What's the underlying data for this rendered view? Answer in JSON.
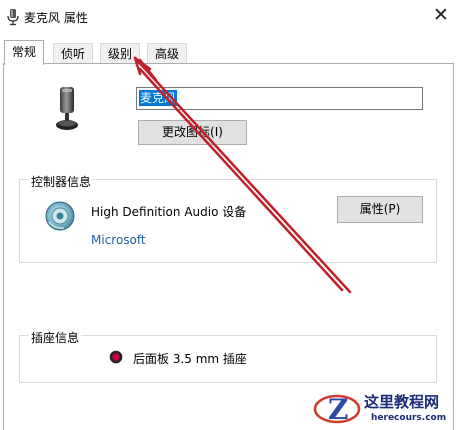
{
  "window": {
    "title": "麦克风 属性",
    "close_symbol": "✕"
  },
  "tabs": [
    {
      "label": "常规",
      "active": true
    },
    {
      "label": "侦听",
      "active": false
    },
    {
      "label": "级别",
      "active": false
    },
    {
      "label": "高级",
      "active": false
    }
  ],
  "general": {
    "device_name_value": "麦克风",
    "change_icon_label": "更改图标(I)"
  },
  "controller": {
    "group_label": "控制器信息",
    "device_name": "High Definition Audio 设备",
    "vendor": "Microsoft",
    "properties_label": "属性(P)"
  },
  "jack": {
    "group_label": "插座信息",
    "description": "后面板 3.5 mm 插座",
    "color": "#c0003c"
  },
  "watermark": {
    "line1": "这里教程网",
    "line2": "herecours.com"
  },
  "colors": {
    "annotation_arrow": "#c0202a",
    "selection": "#0078d7",
    "link": "#1d5ea6"
  }
}
